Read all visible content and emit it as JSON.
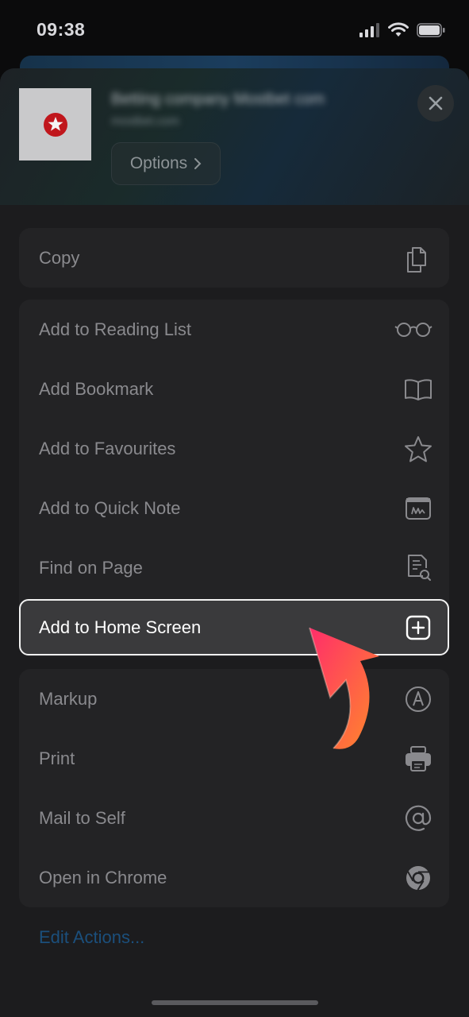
{
  "status_bar": {
    "time": "09:38"
  },
  "header": {
    "title": "Betting company Mostbet com",
    "subtitle": "mostbet.com",
    "options_label": "Options"
  },
  "copy_group": [
    {
      "label": "Copy",
      "icon": "copy-icon"
    }
  ],
  "actions_group": [
    {
      "label": "Add to Reading List",
      "icon": "glasses-icon"
    },
    {
      "label": "Add Bookmark",
      "icon": "book-icon"
    },
    {
      "label": "Add to Favourites",
      "icon": "star-icon"
    },
    {
      "label": "Add to Quick Note",
      "icon": "quick-note-icon"
    },
    {
      "label": "Find on Page",
      "icon": "find-on-page-icon"
    }
  ],
  "highlighted_action": {
    "label": "Add to Home Screen",
    "icon": "plus-square-icon"
  },
  "more_group": [
    {
      "label": "Markup",
      "icon": "markup-icon"
    },
    {
      "label": "Print",
      "icon": "printer-icon"
    },
    {
      "label": "Mail to Self",
      "icon": "at-sign-icon"
    },
    {
      "label": "Open in Chrome",
      "icon": "chrome-icon"
    }
  ],
  "edit_actions_label": "Edit Actions...",
  "colors": {
    "sheet_bg": "#1c1c1e",
    "group_bg": "#232325",
    "highlight_bg": "#3a3a3c",
    "link": "#1b4f7c",
    "arrow_start": "#ff2d6a",
    "arrow_end": "#ff8a2a"
  }
}
